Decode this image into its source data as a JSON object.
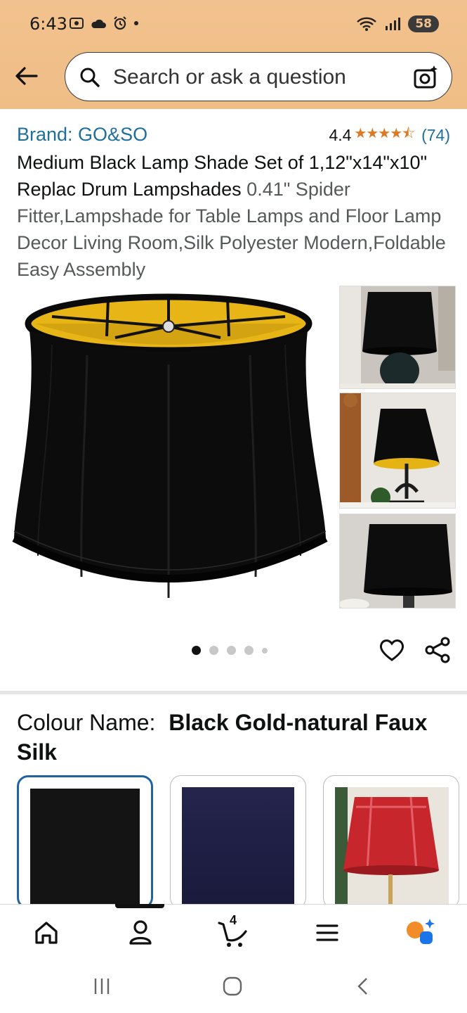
{
  "status_bar": {
    "time": "6:43",
    "battery": "58"
  },
  "search": {
    "placeholder": "Search or ask a question"
  },
  "product": {
    "brand": "Brand: GO&SO",
    "rating": "4.4",
    "stars": "★★★★⯪",
    "review_count": "(74)",
    "title_main": "Medium Black Lamp Shade Set of 1,12\"x14\"x10\" Replac Drum Lampshades",
    "title_rest": "0.41\" Spider Fitter,Lampshade for Table Lamps and Floor Lamp Decor Living Room,Silk Polyester Modern,Foldable Easy Assembly"
  },
  "gallery": {
    "image_count": 5,
    "active_index": 0
  },
  "colour": {
    "label": "Colour Name:",
    "value": "Black Gold-natural Faux Silk",
    "swatches": [
      {
        "name": "black",
        "color": "#141414",
        "selected": true
      },
      {
        "name": "navy",
        "color": "#1f1f45",
        "selected": false
      },
      {
        "name": "red",
        "color": "#c22a2f",
        "selected": false
      }
    ]
  },
  "bottom_nav": {
    "items": [
      "home",
      "account",
      "cart",
      "menu",
      "rufus"
    ],
    "active": "account",
    "cart_count": "4"
  },
  "colors": {
    "header_bg": "#f2c28e",
    "link": "#1f6e9c",
    "star": "#de7921",
    "selected_border": "#2162a1"
  }
}
